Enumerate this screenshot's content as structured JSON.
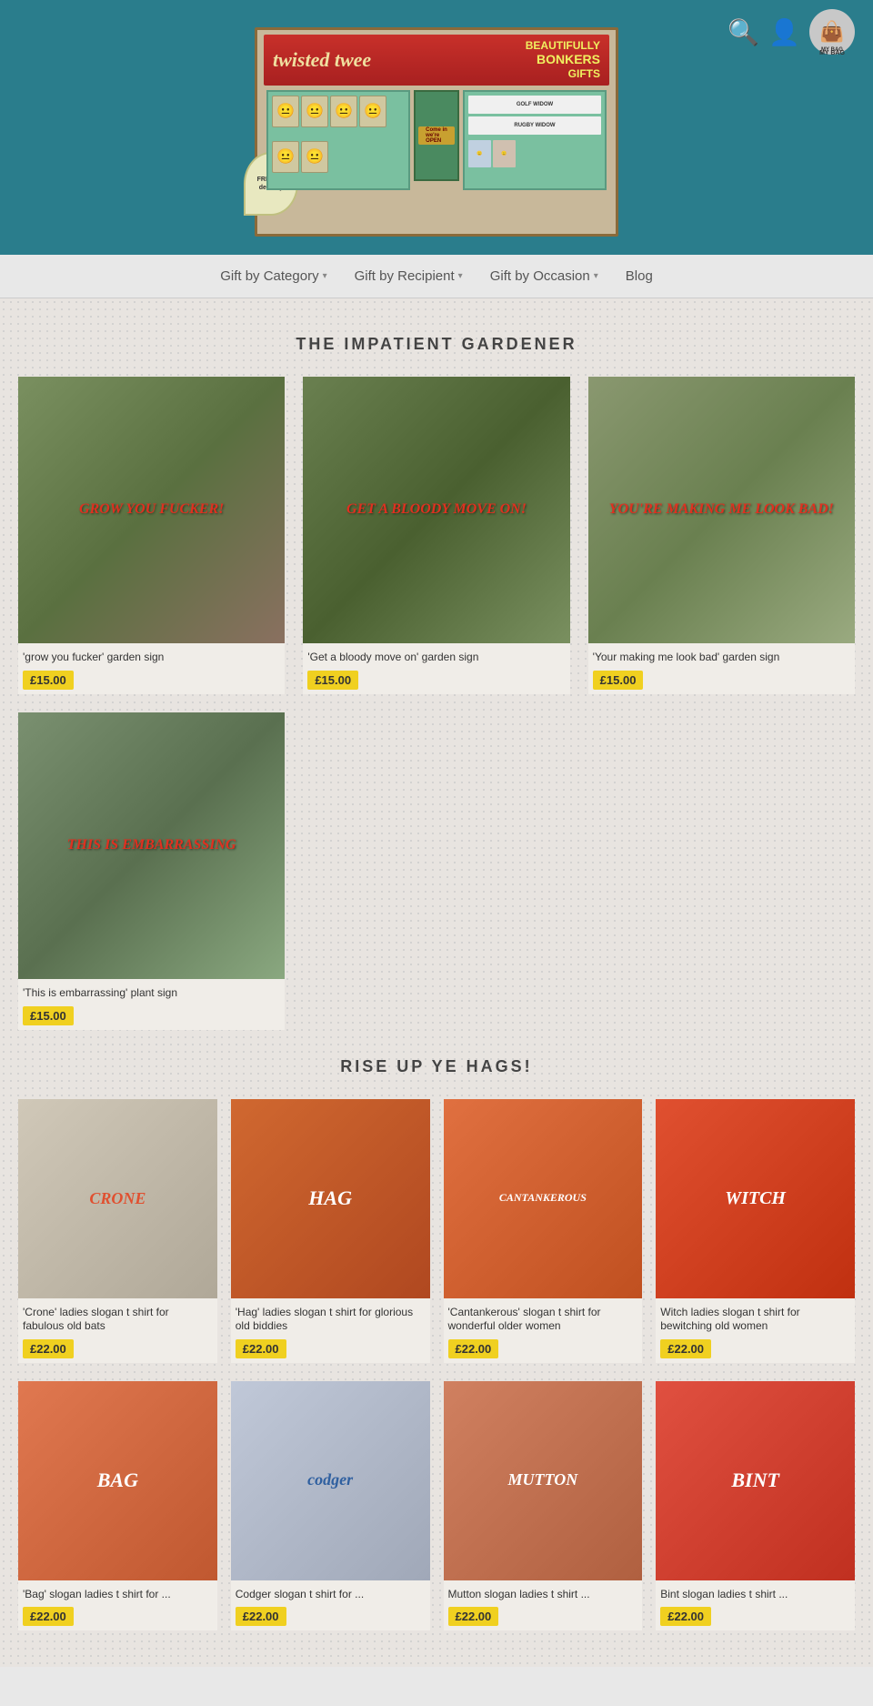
{
  "header": {
    "store_name": "twisted twee",
    "tagline_line1": "BEAUTIFULLY",
    "tagline_line2": "BONKERS",
    "tagline_line3": "GIFTS",
    "free_delivery": "FREE UK delivery",
    "bag_label": "MY BAG"
  },
  "nav": {
    "items": [
      {
        "id": "category",
        "label": "Gift by Category",
        "has_arrow": true
      },
      {
        "id": "recipient",
        "label": "Gift by Recipient",
        "has_arrow": true
      },
      {
        "id": "occasion",
        "label": "Gift by Occasion",
        "has_arrow": true
      },
      {
        "id": "blog",
        "label": "Blog",
        "has_arrow": false
      }
    ]
  },
  "sections": [
    {
      "id": "impatient-gardener",
      "title": "THE IMPATIENT GARDENER",
      "products": [
        {
          "id": "grow-you-fucker",
          "name": "'grow you fucker' garden sign",
          "price": "£15.00",
          "image_text": "GROW YOU\nFUCKER!",
          "img_class": "img-grow"
        },
        {
          "id": "get-a-bloody-move-on",
          "name": "'Get a bloody move on' garden sign",
          "price": "£15.00",
          "image_text": "GET A BLOODY\nMOVE ON!",
          "img_class": "img-move"
        },
        {
          "id": "your-making-me-look-bad",
          "name": "'Your making me look bad' garden sign",
          "price": "£15.00",
          "image_text": "YOU'RE MAKING\nME\nLOOK BAD!",
          "img_class": "img-look"
        }
      ],
      "products_row2": [
        {
          "id": "this-is-embarrassing",
          "name": "'This is embarrassing' plant sign",
          "price": "£15.00",
          "image_text": "THIS IS\nEMBARRASSING",
          "img_class": "img-embarrassing"
        }
      ]
    },
    {
      "id": "rise-up-ye-hags",
      "title": "RISE UP YE HAGS!",
      "products_row1": [
        {
          "id": "crone",
          "name": "'Crone' ladies slogan t shirt for fabulous old bats",
          "price": "£22.00",
          "image_text": "CRONE",
          "img_class": "img-crone"
        },
        {
          "id": "hag",
          "name": "'Hag' ladies slogan t shirt for glorious old biddies",
          "price": "£22.00",
          "image_text": "HAG",
          "img_class": "img-hag"
        },
        {
          "id": "cantankerous",
          "name": "'Cantankerous' slogan t shirt for wonderful older women",
          "price": "£22.00",
          "image_text": "CANTANKEROUS",
          "img_class": "img-cantankerous"
        },
        {
          "id": "witch",
          "name": "Witch ladies slogan t shirt for bewitching old women",
          "price": "£22.00",
          "image_text": "WITCH",
          "img_class": "img-witch"
        }
      ],
      "products_row2": [
        {
          "id": "bag",
          "name": "'Bag' slogan ladies t shirt for ...",
          "price": "£22.00",
          "image_text": "BAG",
          "img_class": "img-bag"
        },
        {
          "id": "codger",
          "name": "Codger slogan t shirt for ...",
          "price": "£22.00",
          "image_text": "codger",
          "img_class": "img-codger"
        },
        {
          "id": "mutton",
          "name": "Mutton slogan ladies t shirt ...",
          "price": "£22.00",
          "image_text": "MUTTON",
          "img_class": "img-mutton"
        },
        {
          "id": "bint",
          "name": "Bint slogan ladies t shirt ...",
          "price": "£22.00",
          "image_text": "BINT",
          "img_class": "img-bint"
        }
      ]
    }
  ]
}
